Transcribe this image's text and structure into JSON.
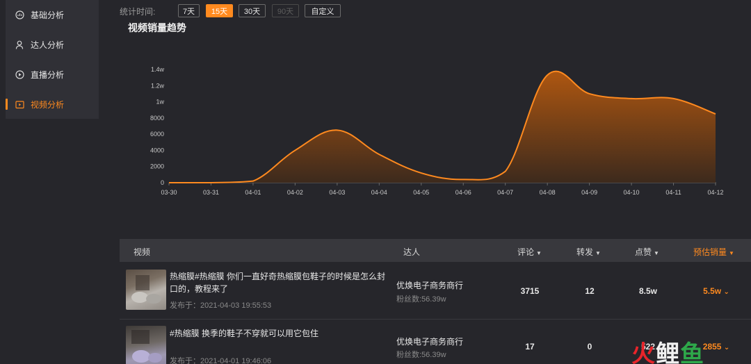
{
  "sidebar": {
    "items": [
      {
        "label": "基础分析",
        "icon": "chart-icon"
      },
      {
        "label": "达人分析",
        "icon": "person-icon"
      },
      {
        "label": "直播分析",
        "icon": "live-icon"
      },
      {
        "label": "视频分析",
        "icon": "video-icon",
        "active": true
      }
    ]
  },
  "filter": {
    "label": "统计时间:",
    "options": [
      "7天",
      "15天",
      "30天",
      "90天",
      "自定义"
    ],
    "selected": "15天",
    "disabled": [
      "90天"
    ]
  },
  "chart_title": "视频销量趋势",
  "chart_data": {
    "type": "area",
    "title": "视频销量趋势",
    "x": [
      "03-30",
      "03-31",
      "04-01",
      "04-02",
      "04-03",
      "04-04",
      "04-05",
      "04-06",
      "04-07",
      "04-08",
      "04-09",
      "04-10",
      "04-11",
      "04-12"
    ],
    "values": [
      0,
      0,
      200,
      4000,
      6500,
      3500,
      1200,
      400,
      1400,
      13300,
      11000,
      10400,
      10400,
      8500
    ],
    "yticks": [
      "0",
      "2000",
      "4000",
      "6000",
      "8000",
      "1w",
      "1.2w",
      "1.4w"
    ],
    "ylim": [
      0,
      14000
    ],
    "color": "#ff8a1f"
  },
  "table": {
    "headers": {
      "video": "视频",
      "creator": "达人",
      "comments": "评论",
      "shares": "转发",
      "likes": "点赞",
      "sales": "预估销量"
    },
    "rows": [
      {
        "title": "热缩膜#热缩膜 你们一直好奇热缩膜包鞋子的时候是怎么封口的，教程来了",
        "date": "发布于：2021-04-03 19:55:53",
        "creator": "优焕电子商务商行",
        "fans": "粉丝数:56.39w",
        "comments": "3715",
        "shares": "12",
        "likes": "8.5w",
        "sales": "5.5w"
      },
      {
        "title": "#热缩膜 换季的鞋子不穿就可以用它包住",
        "date": "发布于：2021-04-01 19:46:06",
        "creator": "优焕电子商务商行",
        "fans": "粉丝数:56.39w",
        "comments": "17",
        "shares": "0",
        "likes": "522",
        "sales": "2855"
      }
    ]
  },
  "watermark": {
    "chars": [
      "火",
      "鲤",
      "鱼"
    ]
  }
}
